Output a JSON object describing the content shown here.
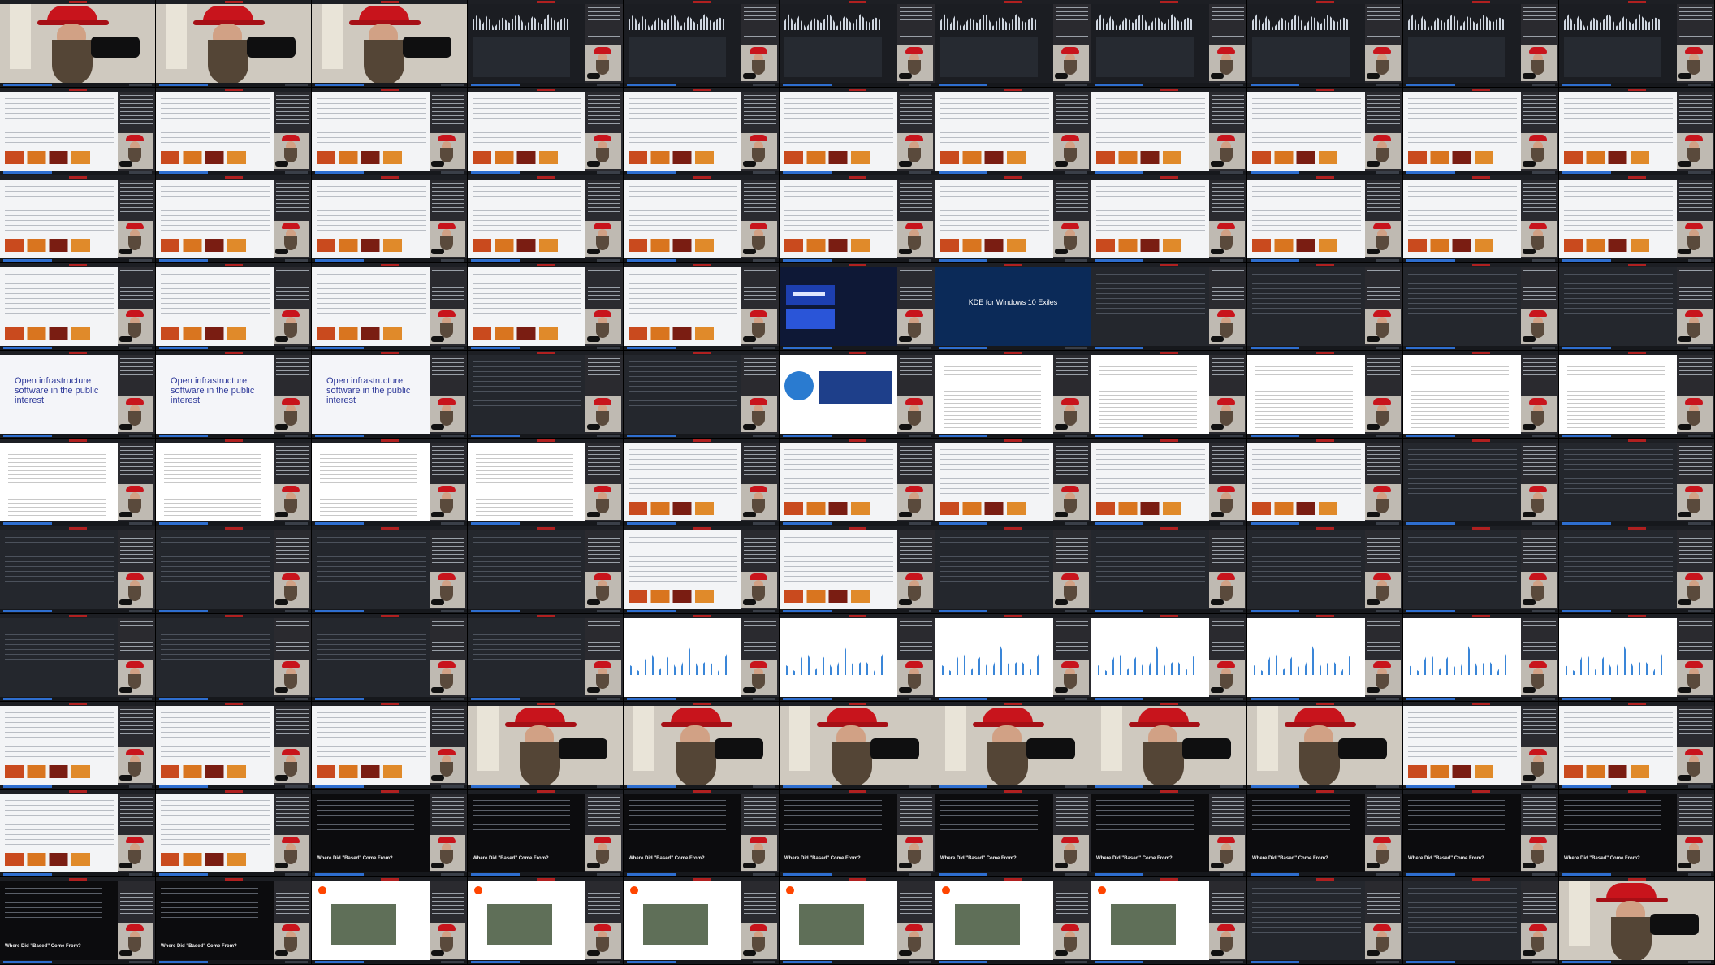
{
  "grid": {
    "columns": 11,
    "rows": 11
  },
  "colors": {
    "hat": "#c8141c",
    "chat_panel": "#2a2a2f",
    "taskbar": "#16181c",
    "accent": "#2e6ecf"
  },
  "visible_text": {
    "slide_title": "Open infrastructure software in the public interest",
    "banner_title": "KDE for Windows 10 Exiles",
    "reddit_headline": "Where Did \"Based\" Come From?"
  },
  "tiles": [
    "cam",
    "cam",
    "cam",
    "audio",
    "audio",
    "audio",
    "audio",
    "audio",
    "audio",
    "audio",
    "audio",
    "web-light",
    "web-light",
    "web-light",
    "web-light",
    "web-light",
    "web-light",
    "web-light",
    "web-light",
    "web-light",
    "web-light",
    "web-light",
    "web-light",
    "web-light",
    "web-light",
    "web-light",
    "web-light",
    "web-light",
    "web-light",
    "web-light",
    "web-light",
    "web-light",
    "web-light",
    "web-light",
    "web-light",
    "web-light",
    "web-light",
    "web-light",
    "promo",
    "banner",
    "web-dark",
    "web-dark",
    "web-dark",
    "web-dark",
    "slide",
    "slide",
    "slide",
    "web-dark",
    "web-dark",
    "books",
    "doc",
    "doc",
    "doc",
    "doc",
    "doc",
    "doc",
    "doc",
    "doc",
    "doc",
    "web-light",
    "web-light",
    "web-light",
    "web-light",
    "web-light",
    "web-dark",
    "web-dark",
    "web-dark",
    "web-dark",
    "web-dark",
    "web-dark",
    "web-light",
    "web-light",
    "web-dark",
    "web-dark",
    "web-dark",
    "web-dark",
    "web-dark",
    "web-dark",
    "web-dark",
    "web-dark",
    "web-dark",
    "dash",
    "dash",
    "dash",
    "dash",
    "dash",
    "dash",
    "dash",
    "web-light",
    "web-light",
    "web-light",
    "cam",
    "cam",
    "cam",
    "cam",
    "cam",
    "cam",
    "web-light",
    "web-light",
    "web-light",
    "web-light",
    "headline",
    "headline",
    "headline",
    "headline",
    "headline",
    "headline",
    "headline",
    "headline",
    "headline",
    "headline",
    "headline",
    "reddit",
    "reddit",
    "reddit",
    "reddit",
    "reddit",
    "reddit",
    "web-dark",
    "web-dark",
    "cam"
  ]
}
